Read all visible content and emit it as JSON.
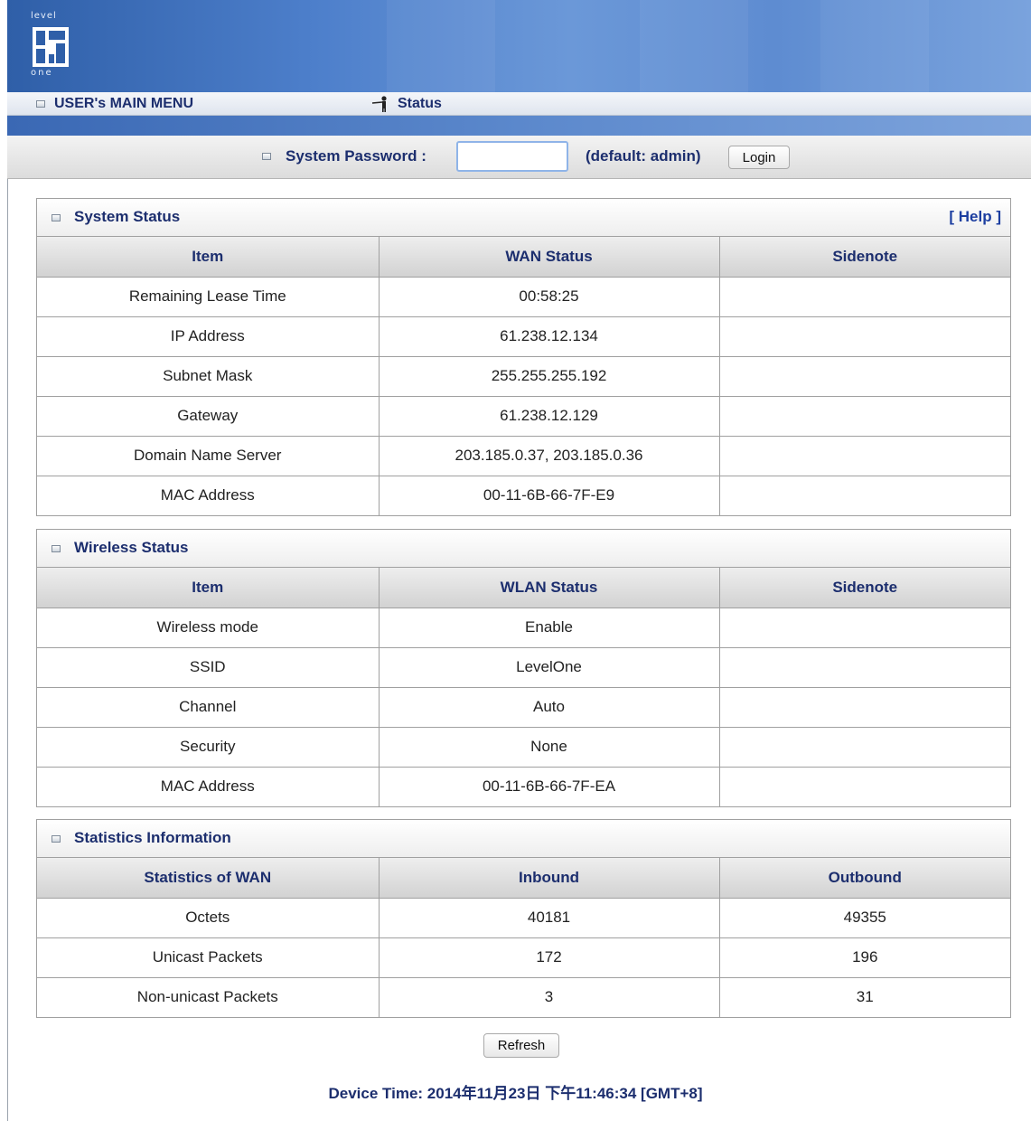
{
  "header": {
    "logo_top_text": "level",
    "logo_bottom_text": "one",
    "menu_title": "USER's MAIN MENU",
    "current_page": "Status"
  },
  "login": {
    "label": "System Password :",
    "password_value": "",
    "hint": "(default: admin)",
    "login_label": "Login"
  },
  "system_status": {
    "title": "System Status",
    "help_label": "[ Help ]",
    "headers": [
      "Item",
      "WAN Status",
      "Sidenote"
    ],
    "rows": [
      [
        "Remaining Lease Time",
        "00:58:25",
        ""
      ],
      [
        "IP Address",
        "61.238.12.134",
        ""
      ],
      [
        "Subnet Mask",
        "255.255.255.192",
        ""
      ],
      [
        "Gateway",
        "61.238.12.129",
        ""
      ],
      [
        "Domain Name Server",
        "203.185.0.37, 203.185.0.36",
        ""
      ],
      [
        "MAC Address",
        "00-11-6B-66-7F-E9",
        ""
      ]
    ]
  },
  "wireless_status": {
    "title": "Wireless Status",
    "headers": [
      "Item",
      "WLAN Status",
      "Sidenote"
    ],
    "rows": [
      [
        "Wireless mode",
        "Enable",
        ""
      ],
      [
        "SSID",
        "LevelOne",
        ""
      ],
      [
        "Channel",
        "Auto",
        ""
      ],
      [
        "Security",
        "None",
        ""
      ],
      [
        "MAC Address",
        "00-11-6B-66-7F-EA",
        ""
      ]
    ]
  },
  "statistics": {
    "title": "Statistics Information",
    "headers": [
      "Statistics of WAN",
      "Inbound",
      "Outbound"
    ],
    "rows": [
      [
        "Octets",
        "40181",
        "49355"
      ],
      [
        "Unicast Packets",
        "172",
        "196"
      ],
      [
        "Non-unicast Packets",
        "3",
        "31"
      ]
    ]
  },
  "footer": {
    "refresh_label": "Refresh",
    "device_time": "Device Time: 2014年11月23日 下午11:46:34 [GMT+8]"
  }
}
